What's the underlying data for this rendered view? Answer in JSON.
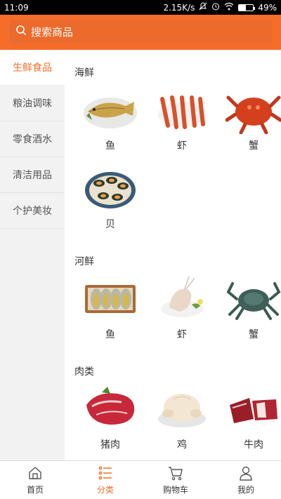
{
  "status_bar": {
    "time": "11:09",
    "network_speed": "2.15K/s",
    "battery": "49%",
    "battery_level": 0.49
  },
  "search": {
    "placeholder": "搜索商品"
  },
  "colors": {
    "accent": "#f56d28",
    "sidebar_bg": "#f2f2f2"
  },
  "sidebar": {
    "items": [
      {
        "label": "生鲜食品",
        "active": true
      },
      {
        "label": "粮油调味",
        "active": false
      },
      {
        "label": "零食酒水",
        "active": false
      },
      {
        "label": "清洁用品",
        "active": false
      },
      {
        "label": "个护美妆",
        "active": false
      }
    ]
  },
  "sections": [
    {
      "title": "海鲜",
      "items": [
        {
          "label": "鱼",
          "icon": "fish-icon"
        },
        {
          "label": "虾",
          "icon": "shrimp-icon"
        },
        {
          "label": "蟹",
          "icon": "king-crab-icon"
        },
        {
          "label": "贝",
          "icon": "mussel-icon"
        }
      ]
    },
    {
      "title": "河鲜",
      "items": [
        {
          "label": "鱼",
          "icon": "river-fish-icon"
        },
        {
          "label": "虾",
          "icon": "river-shrimp-icon"
        },
        {
          "label": "蟹",
          "icon": "river-crab-icon"
        }
      ]
    },
    {
      "title": "肉类",
      "items": [
        {
          "label": "猪肉",
          "icon": "pork-icon"
        },
        {
          "label": "鸡",
          "icon": "chicken-icon"
        },
        {
          "label": "牛肉",
          "icon": "beef-icon"
        }
      ]
    }
  ],
  "tabbar": {
    "items": [
      {
        "label": "首页",
        "icon": "home-icon",
        "active": false
      },
      {
        "label": "分类",
        "icon": "category-list-icon",
        "active": true
      },
      {
        "label": "购物车",
        "icon": "cart-icon",
        "active": false
      },
      {
        "label": "我的",
        "icon": "profile-icon",
        "active": false
      }
    ]
  }
}
